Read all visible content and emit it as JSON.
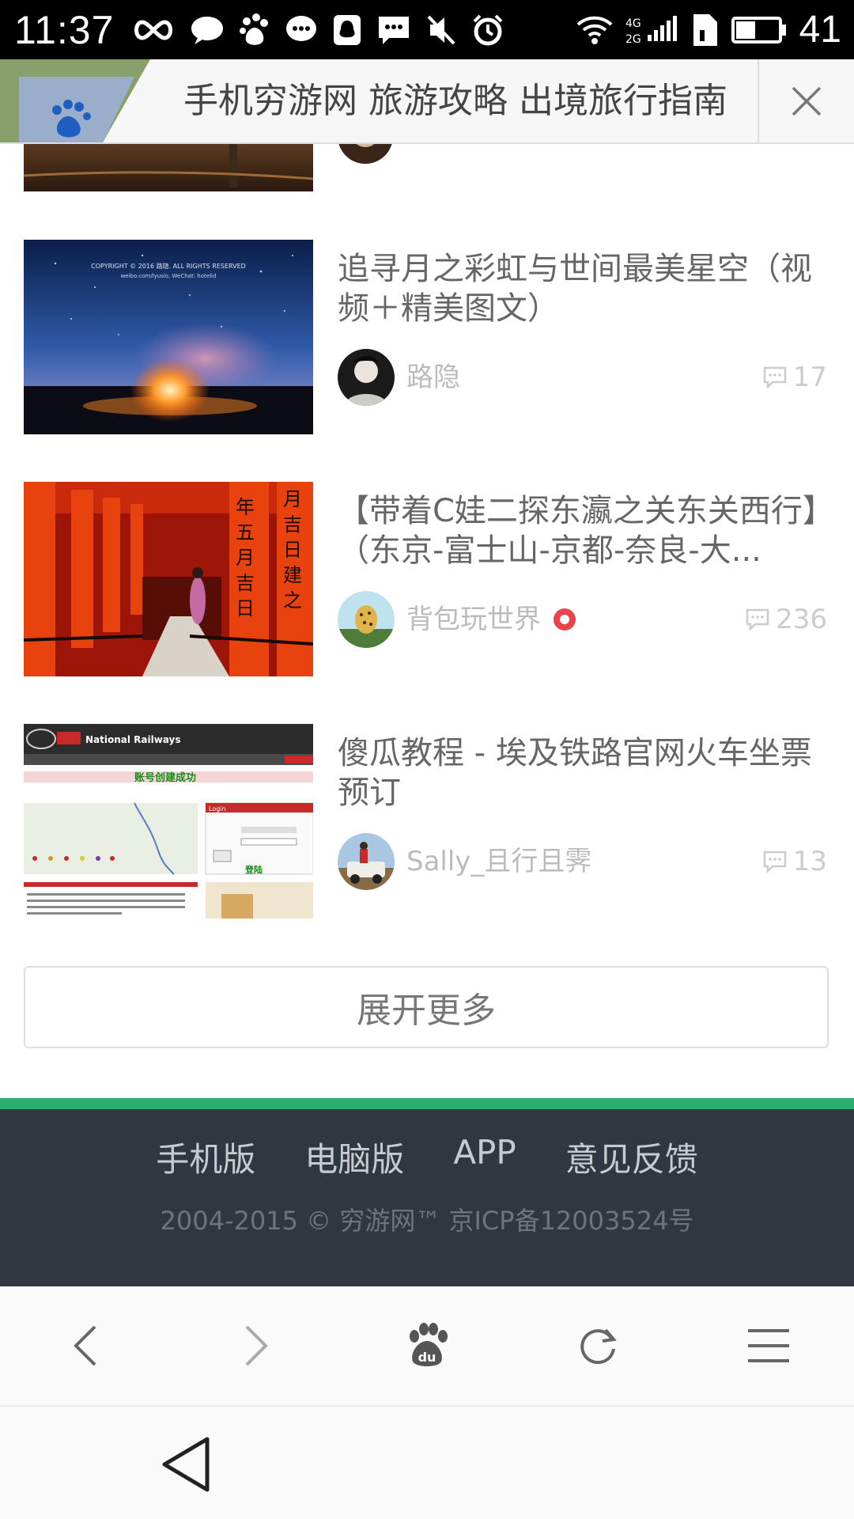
{
  "status_bar": {
    "time": "11:37",
    "network_label": "4G 2G",
    "battery_level": "41",
    "icons": [
      "infinity-icon",
      "chat-bubble-icon",
      "baidu-paw-icon",
      "message-icon",
      "qq-icon",
      "sms-icon",
      "mute-icon",
      "alarm-icon",
      "wifi-icon",
      "signal-icon",
      "sim-icon",
      "battery-icon"
    ]
  },
  "title_bar": {
    "title": "手机穷游网 旅游攻略 出境旅行指南",
    "close_icon": "close-icon"
  },
  "articles": [
    {
      "title": "追寻月之彩虹与世间最美星空（视频＋精美图文）",
      "author": "路隐",
      "comments": "17",
      "verified": false,
      "thumb_caption_1": "COPYRIGHT © 2016 路隐. ALL RIGHTS RESERVED",
      "thumb_caption_2": "weibo.com/lyusio, WeChat: hotelid"
    },
    {
      "title": "【带着C娃二探东瀛之关东关西行】（东京-富士山-京都-奈良-大...",
      "author": "背包玩世界",
      "comments": "236",
      "verified": true
    },
    {
      "title": "傻瓜教程 - 埃及铁路官网火车坐票预订",
      "author": "Sally_且行且霁",
      "comments": "13",
      "verified": false,
      "thumb_header": "National Railways",
      "thumb_success": "账号创建成功",
      "thumb_login": "Login",
      "thumb_submit": "登陆"
    }
  ],
  "expand_button": "展开更多",
  "footer": {
    "links": [
      "手机版",
      "电脑版",
      "APP",
      "意见反馈"
    ],
    "copyright": "2004-2015 © 穷游网™ 京ICP备12003524号",
    "accent_color": "#2aad6f",
    "background_color": "#2f3841"
  },
  "browser_toolbar": {
    "buttons": [
      "back-arrow-icon",
      "forward-arrow-icon",
      "baidu-home-icon",
      "refresh-icon",
      "menu-icon"
    ]
  },
  "system_nav": {
    "back": "nav-back-icon"
  }
}
